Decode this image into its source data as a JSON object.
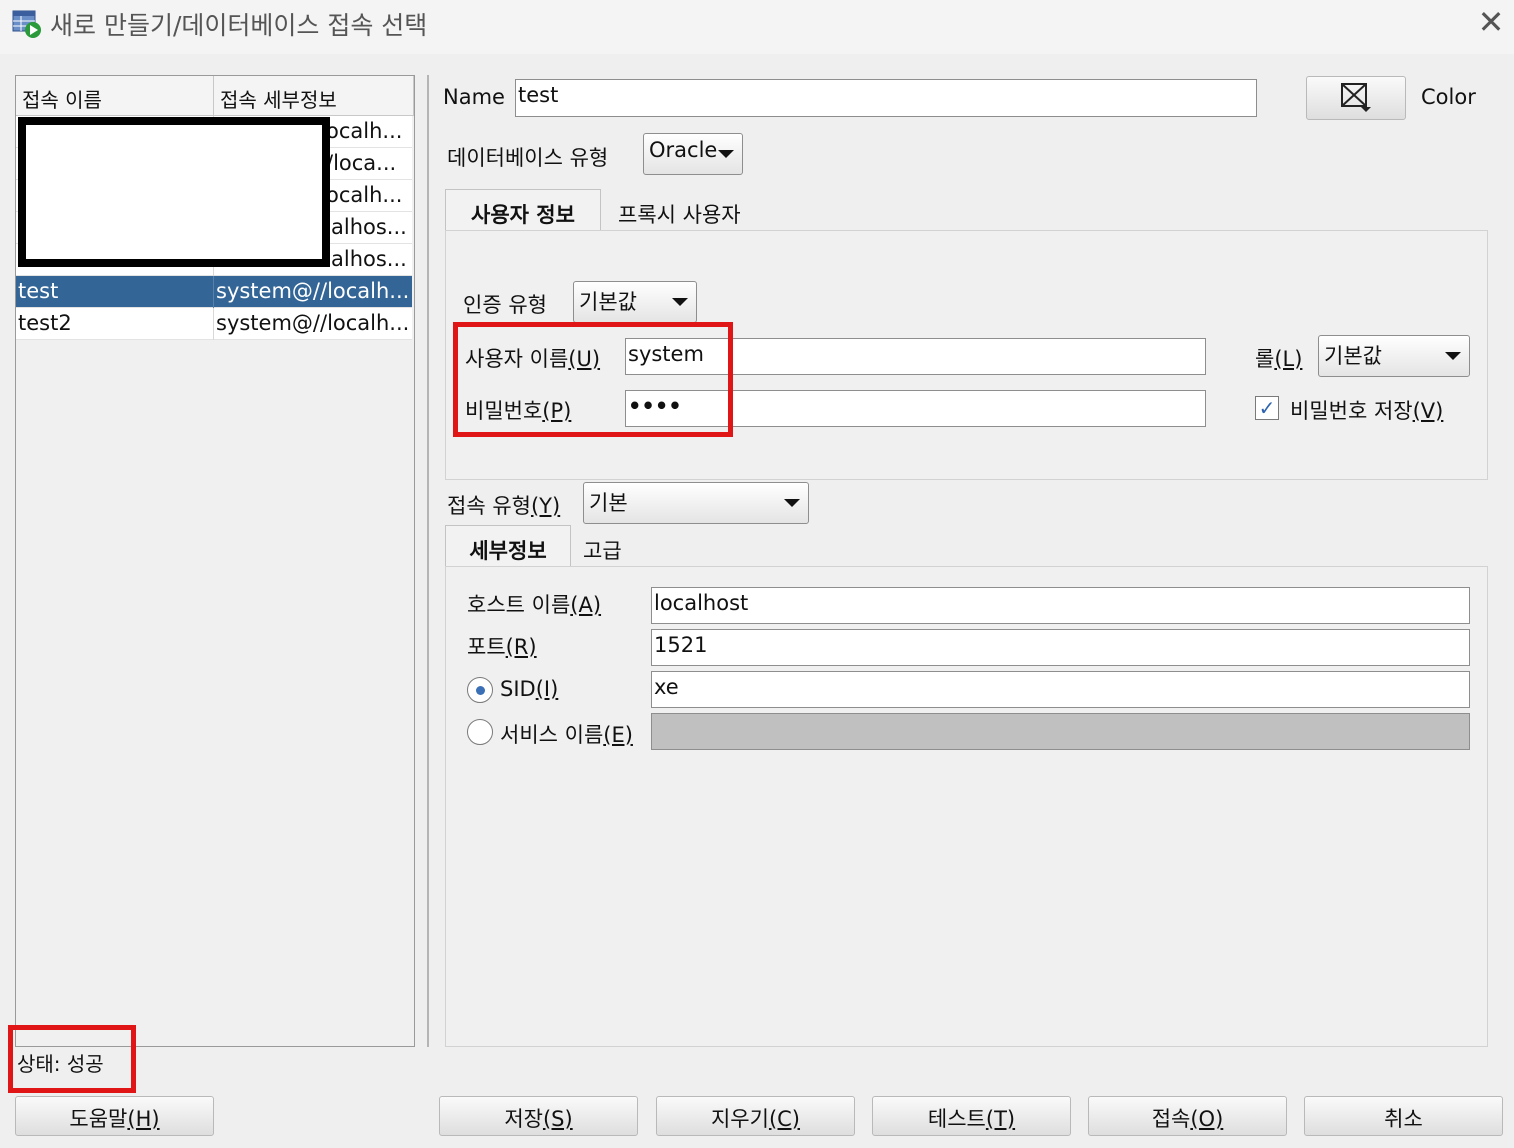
{
  "window": {
    "title": "새로 만들기/데이터베이스 접속 선택",
    "close_glyph": "✕"
  },
  "list": {
    "headers": [
      "접속 이름",
      "접속 세부정보"
    ],
    "rows": [
      {
        "name": "",
        "detail": "ocalh..."
      },
      {
        "name": "",
        "detail": "/loca..."
      },
      {
        "name": "",
        "detail": "ocalh..."
      },
      {
        "name": "",
        "detail": "alhos..."
      },
      {
        "name": "",
        "detail": "alhos..."
      },
      {
        "name": "test",
        "detail": "system@//localh..."
      },
      {
        "name": "test2",
        "detail": "system@//localh..."
      }
    ]
  },
  "status": {
    "text": "상태: 성공"
  },
  "form": {
    "name_label": "Name",
    "name_value": "test",
    "color_label": "Color",
    "db_type_label": "데이터베이스 유형",
    "db_type_value": "Oracle",
    "tabs_user": {
      "active": "사용자 정보",
      "other": "프록시 사용자"
    },
    "auth_type_label": "인증 유형",
    "auth_type_value": "기본값",
    "username_label": "사용자 이름",
    "username_mnemonic": "(U)",
    "username_value": "system",
    "password_label": "비밀번호",
    "password_mnemonic": "(P)",
    "password_value": "••••",
    "role_label": "롤",
    "role_mnemonic": "(L)",
    "role_value": "기본값",
    "save_password_label": "비밀번호 저장",
    "save_password_mnemonic": "(V)",
    "save_password_checked": true,
    "conn_type_label": "접속 유형",
    "conn_type_mnemonic": "(Y)",
    "conn_type_value": "기본",
    "tabs_detail": {
      "active": "세부정보",
      "other": "고급"
    },
    "host_label": "호스트 이름",
    "host_mnemonic": "(A)",
    "host_value": "localhost",
    "port_label": "포트",
    "port_mnemonic": "(R)",
    "port_value": "1521",
    "sid_label": "SID",
    "sid_mnemonic": "(I)",
    "sid_value": "xe",
    "service_label": "서비스 이름",
    "service_mnemonic": "(E)",
    "service_value": ""
  },
  "buttons": {
    "help": "도움말",
    "help_m": "(H)",
    "save": "저장",
    "save_m": "(S)",
    "clear": "지우기",
    "clear_m": "(C)",
    "test": "테스트",
    "test_m": "(T)",
    "connect": "접속",
    "connect_m": "(O)",
    "cancel": "취소"
  },
  "colors": {
    "selection": "#336596",
    "highlight_red": "#e01616",
    "checkbox_blue": "#2d64b0"
  }
}
